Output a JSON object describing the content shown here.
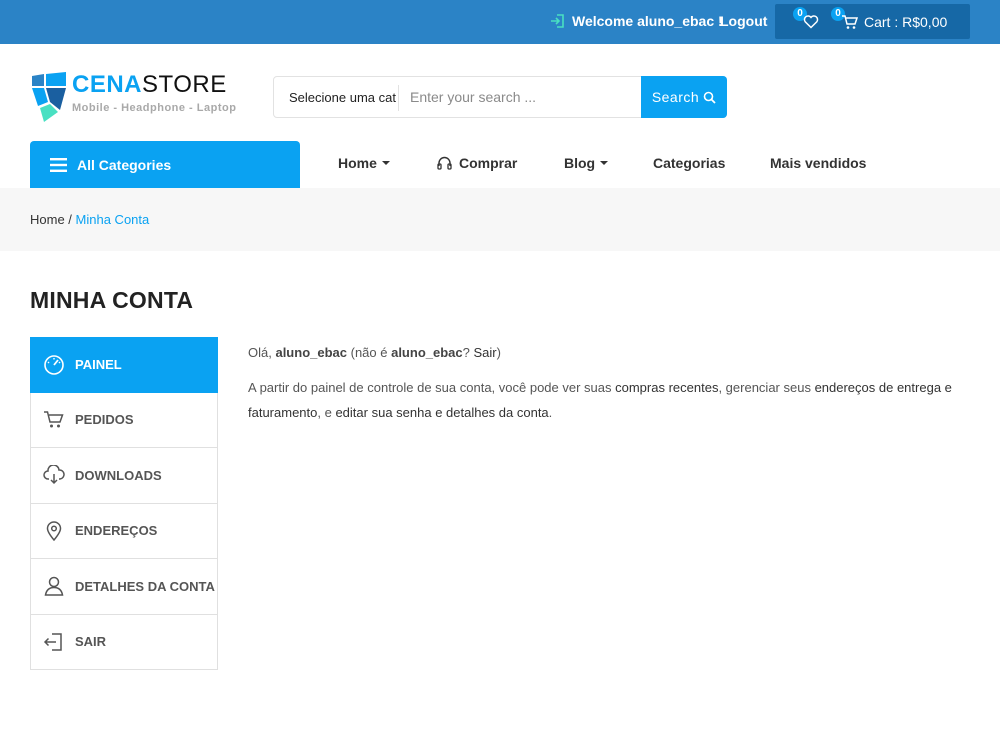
{
  "topbar": {
    "welcome": "Welcome aluno_ebac !",
    "logout": "Logout",
    "wishlist_count": "0",
    "cart_count": "0",
    "cart_label": "Cart : R$0,00"
  },
  "logo": {
    "brand_bold": "CENA",
    "brand_light": "STORE",
    "tagline": "Mobile - Headphone - Laptop"
  },
  "search": {
    "category": "Selecione uma cat",
    "placeholder": "Enter your search ...",
    "button": "Search"
  },
  "nav": {
    "all_categories": "All Categories",
    "items": [
      "Home",
      "Comprar",
      "Blog",
      "Categorias",
      "Mais vendidos"
    ]
  },
  "breadcrumb": {
    "home": "Home",
    "sep": " / ",
    "current": "Minha Conta"
  },
  "page": {
    "title": "MINHA CONTA"
  },
  "account_menu": [
    {
      "label": "PAINEL",
      "icon": "dashboard-icon",
      "active": true
    },
    {
      "label": "PEDIDOS",
      "icon": "cart-icon",
      "active": false
    },
    {
      "label": "DOWNLOADS",
      "icon": "cloud-download-icon",
      "active": false
    },
    {
      "label": "ENDEREÇOS",
      "icon": "location-pin-icon",
      "active": false
    },
    {
      "label": "DETALHES DA CONTA",
      "icon": "user-icon",
      "active": false
    },
    {
      "label": "SAIR",
      "icon": "logout-icon",
      "active": false
    }
  ],
  "dashboard": {
    "hello": "Olá, ",
    "username": "aluno_ebac",
    "not_prefix": " (não é ",
    "username2": "aluno_ebac",
    "qmark": "? ",
    "logout_link": "Sair",
    "close_paren": ")",
    "p2_a": "A partir do painel de controle de sua conta, você pode ver suas ",
    "recent_orders": "compras recentes",
    "p2_b": ", gerenciar seus ",
    "addresses": "endereços de entrega e faturamento",
    "p2_c": ", e ",
    "edit_account": "editar sua senha e detalhes da conta",
    "p2_d": "."
  },
  "colors": {
    "topbar": "#2b83c6",
    "accent": "#0aa2f2",
    "cartbox": "#1668a6"
  }
}
